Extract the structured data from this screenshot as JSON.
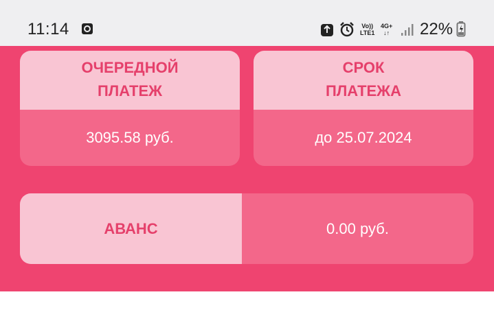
{
  "status_bar": {
    "time": "11:14",
    "battery_percent": "22%",
    "network_top": "Vo))",
    "network_bottom": "LTE1",
    "mobile_data_top": "4G+",
    "mobile_data_bottom": "↓↑",
    "icons": [
      "screen-record-icon",
      "recycle-icon",
      "alarm-icon",
      "volte-icon",
      "mobile-data-icon",
      "signal-icon",
      "battery-charging-icon"
    ]
  },
  "payment": {
    "next_payment": {
      "title_line1": "ОЧЕРЕДНОЙ",
      "title_line2": "ПЛАТЕЖ",
      "value": "3095.58 руб."
    },
    "due_date": {
      "title_line1": "СРОК",
      "title_line2": "ПЛАТЕЖА",
      "value": "до 25.07.2024"
    },
    "advance": {
      "label": "АВАНС",
      "value": "0.00 руб."
    }
  },
  "colors": {
    "background": "#ef4470",
    "card_header": "#f9c5d3",
    "card_body": "#f3678a",
    "header_text": "#e5406b",
    "value_text": "#ffffff"
  }
}
